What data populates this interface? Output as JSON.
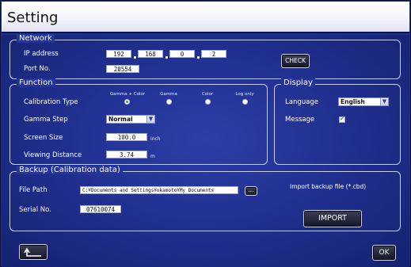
{
  "window": {
    "title": "Setting"
  },
  "network": {
    "legend": "Network",
    "ip_label": "IP address",
    "ip": [
      "192",
      "168",
      "0",
      "2"
    ],
    "port_label": "Port No.",
    "port": "20554",
    "check_label": "CHECK"
  },
  "function": {
    "legend": "Function",
    "calibration_label": "Calibration Type",
    "calibration_options": [
      "Gamma + Color",
      "Gamma",
      "Color",
      "Log only"
    ],
    "calibration_selected": "Gamma + Color",
    "gamma_label": "Gamma Step",
    "gamma_value": "Normal",
    "screen_label": "Screen Size",
    "screen_value": "100.0",
    "screen_unit": "inch",
    "viewing_label": "Viewing Distance",
    "viewing_value": "3.74",
    "viewing_unit": "m"
  },
  "display": {
    "legend": "Display",
    "language_label": "Language",
    "language_value": "English",
    "message_label": "Message",
    "message_checked": true,
    "check_mark": "✔"
  },
  "backup": {
    "legend": "Backup (Calibration data)",
    "file_path_label": "File Path",
    "file_path_value": "C:¥Documents and Settings¥okamoto¥My Documents",
    "browse_label": "...",
    "serial_label": "Serial No.",
    "serial_value": "07610074",
    "import_hint": "Import backup file (*.cbd)",
    "import_label": "IMPORT"
  },
  "footer": {
    "back_icon": "return-arrow-icon",
    "ok_label": "OK"
  },
  "colors": {
    "background": "#1f2f8a",
    "titlebar": "#ffffff",
    "radio_selected": "#2bb36a"
  }
}
